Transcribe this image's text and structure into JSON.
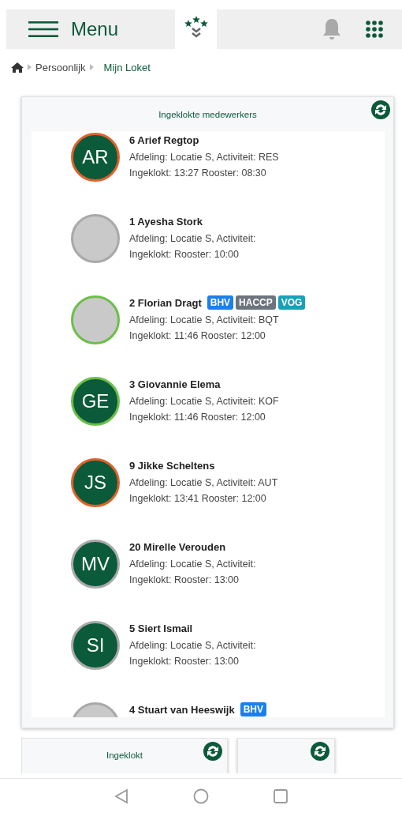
{
  "header": {
    "menu_label": "Menu"
  },
  "breadcrumb": [
    {
      "label": "Persoonlijk",
      "selected": false
    },
    {
      "label": "Mijn Loket",
      "selected": true
    }
  ],
  "panel": {
    "title": "Ingeklokte medewerkers",
    "employees": [
      {
        "name": "6 Arief Regtop",
        "avatar": {
          "kind": "initials",
          "text": "AR"
        },
        "color": "#e0612b",
        "line1": "Afdeling: Locatie S, Activiteit: RES",
        "line2": "Ingeklokt: 13:27 Rooster: 08:30"
      },
      {
        "name": "1 Ayesha Stork",
        "avatar": {
          "kind": "photo"
        },
        "color": "#a9a9a9",
        "line1": "Afdeling: Locatie S, Activiteit:",
        "line2": "Ingeklokt: Rooster: 10:00"
      },
      {
        "name": "2 Florian Dragt",
        "avatar": {
          "kind": "photo"
        },
        "color": "#6cbf4a",
        "line1": "Afdeling: Locatie S, Activiteit: BQT",
        "line2": "Ingeklokt: 11:46 Rooster: 12:00",
        "badges": [
          {
            "label": "BHV",
            "color": "#1a7ff0"
          },
          {
            "label": "HACCP",
            "color": "#6c757d"
          },
          {
            "label": "VOG",
            "color": "#17a2b8"
          }
        ]
      },
      {
        "name": "3 Giovannie Elema",
        "avatar": {
          "kind": "initials",
          "text": "GE"
        },
        "color": "#6cbf4a",
        "line1": "Afdeling: Locatie S, Activiteit: KOF",
        "line2": "Ingeklokt: 11:46 Rooster: 12:00"
      },
      {
        "name": "9 Jikke Scheltens",
        "avatar": {
          "kind": "initials",
          "text": "JS"
        },
        "color": "#e0612b",
        "line1": "Afdeling: Locatie S, Activiteit: AUT",
        "line2": "Ingeklokt: 13:41 Rooster: 12:00"
      },
      {
        "name": "20 Mirelle Verouden",
        "avatar": {
          "kind": "initials",
          "text": "MV"
        },
        "color": "#a9a9a9",
        "line1": "Afdeling: Locatie S, Activiteit:",
        "line2": "Ingeklokt: Rooster: 13:00"
      },
      {
        "name": "5 Siert Ismail",
        "avatar": {
          "kind": "initials",
          "text": "SI"
        },
        "color": "#a9a9a9",
        "line1": "Afdeling: Locatie S, Activiteit:",
        "line2": "Ingeklokt: Rooster: 13:00"
      },
      {
        "name": "4 Stuart van Heeswijk",
        "avatar": {
          "kind": "photo"
        },
        "color": "#a9a9a9",
        "badges": [
          {
            "label": "BHV",
            "color": "#1a7ff0"
          }
        ]
      }
    ]
  },
  "bottom_panels": [
    {
      "title": "Ingeklokt",
      "refresh_button": true
    },
    {
      "refresh_button": true
    }
  ]
}
